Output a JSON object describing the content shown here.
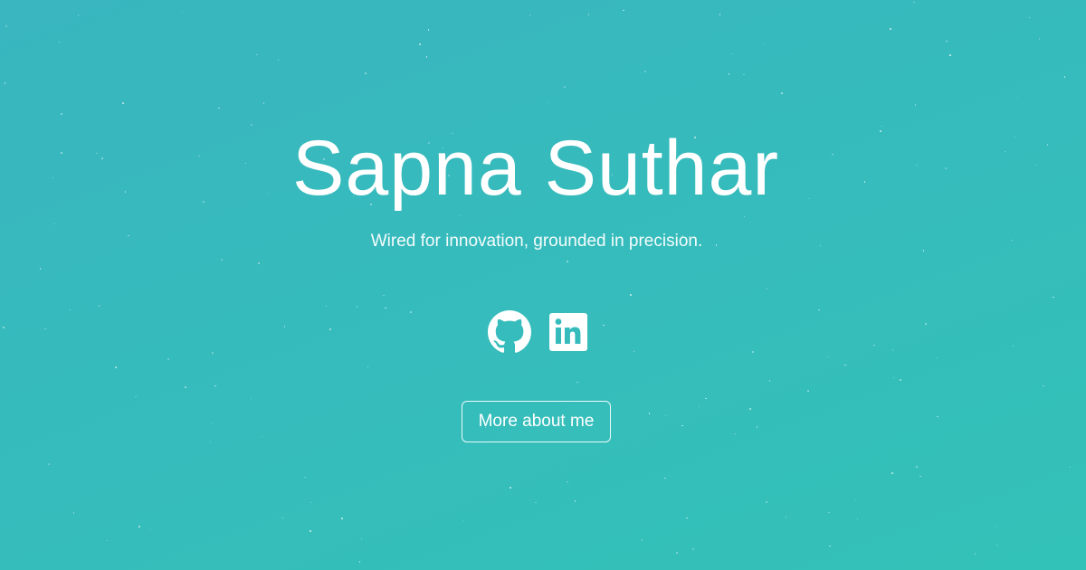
{
  "hero": {
    "name": "Sapna Suthar",
    "tagline": "Wired for innovation, grounded in precision.",
    "background_colors": [
      "#39b6bf",
      "#33c2b8"
    ]
  },
  "socials": [
    {
      "icon": "github-icon",
      "label": "GitHub"
    },
    {
      "icon": "linkedin-icon",
      "label": "LinkedIn"
    }
  ],
  "cta": {
    "label": "More about me"
  }
}
